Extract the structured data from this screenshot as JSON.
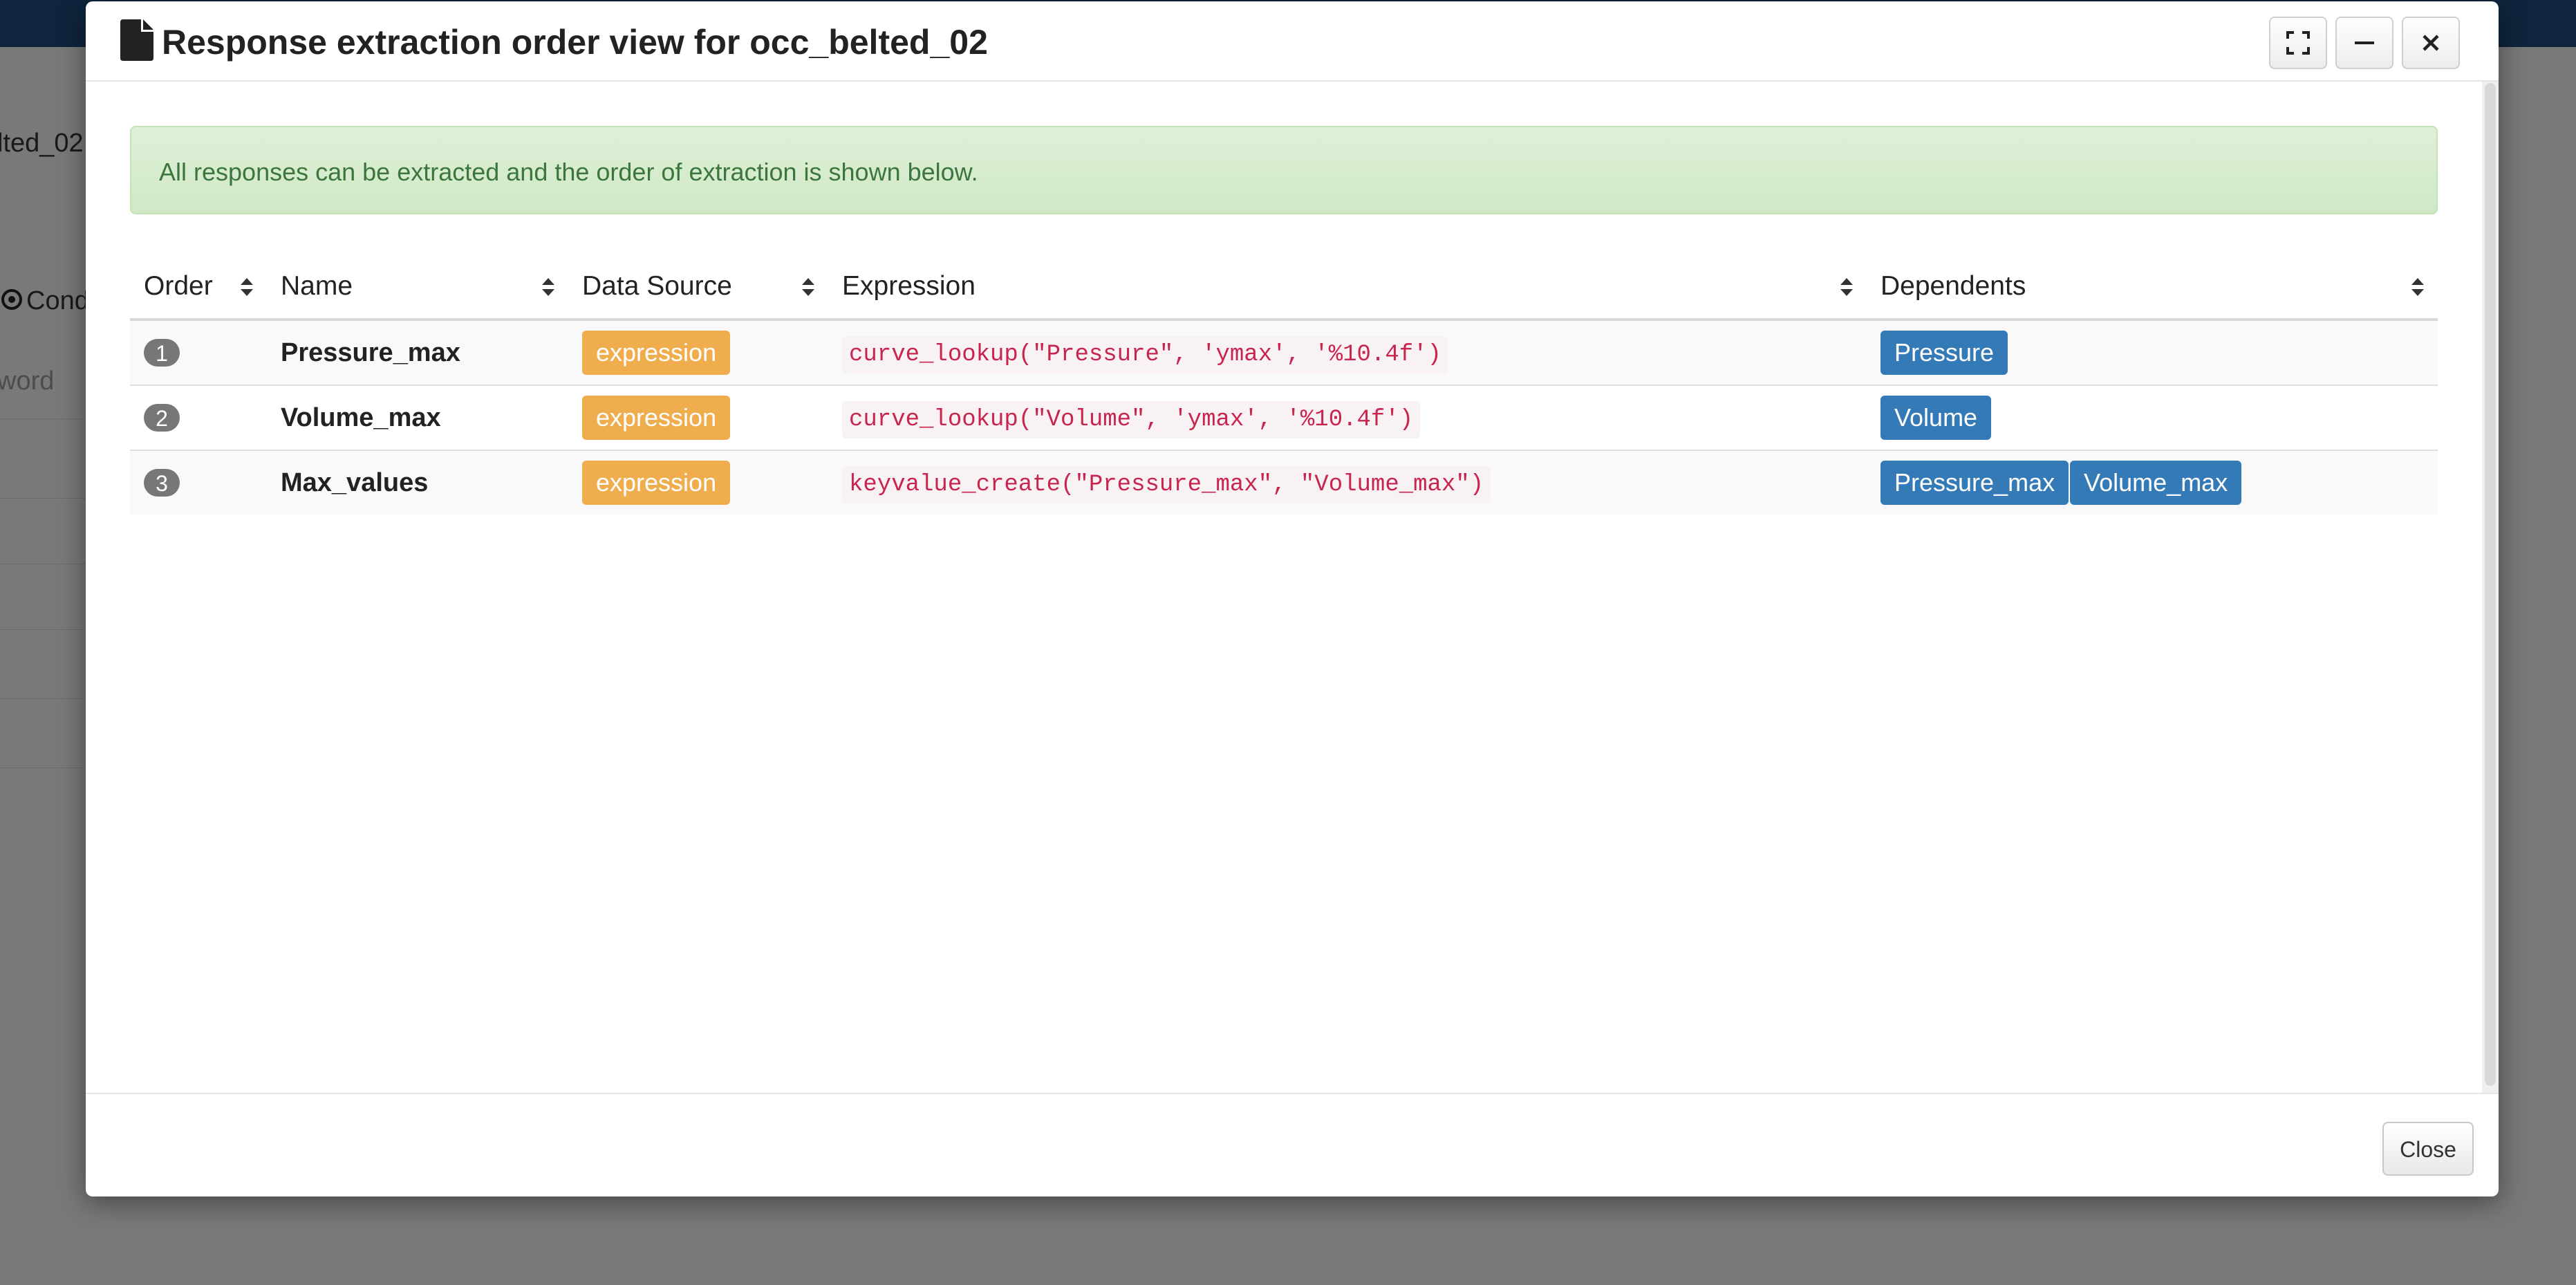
{
  "background": {
    "fragment_1": "lted_02",
    "fragment_2": "Cond",
    "fragment_3": "word"
  },
  "modal": {
    "title": "Response extraction order view for occ_belted_02",
    "alert": "All responses can be extracted and the order of extraction is shown below.",
    "columns": [
      "Order",
      "Name",
      "Data Source",
      "Expression",
      "Dependents"
    ],
    "rows": [
      {
        "order": "1",
        "name": "Pressure_max",
        "data_source": "expression",
        "expression": "curve_lookup(\"Pressure\", 'ymax', '%10.4f')",
        "dependents": [
          "Pressure"
        ]
      },
      {
        "order": "2",
        "name": "Volume_max",
        "data_source": "expression",
        "expression": "curve_lookup(\"Volume\", 'ymax', '%10.4f')",
        "dependents": [
          "Volume"
        ]
      },
      {
        "order": "3",
        "name": "Max_values",
        "data_source": "expression",
        "expression": "keyvalue_create(\"Pressure_max\", \"Volume_max\")",
        "dependents": [
          "Pressure_max",
          "Volume_max"
        ]
      }
    ],
    "footer": {
      "close_label": "Close"
    }
  },
  "colors": {
    "accent_primary": "#337ab7",
    "warning": "#f0ad4e",
    "success_bg": "#dff0d8",
    "code": "#c7254e"
  }
}
